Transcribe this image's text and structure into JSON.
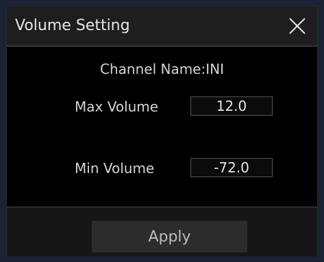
{
  "dialog": {
    "title": "Volume Setting",
    "close_icon": "close-icon",
    "channel_label": "Channel Name:INI",
    "max_volume": {
      "label": "Max Volume",
      "value": "12.0"
    },
    "min_volume": {
      "label": "Min Volume",
      "value": "-72.0"
    },
    "apply_label": "Apply"
  },
  "colors": {
    "background": "#000000",
    "titlebar": "#1e1e1e",
    "text": "#d4d4d4",
    "button": "#2c2c2c"
  }
}
